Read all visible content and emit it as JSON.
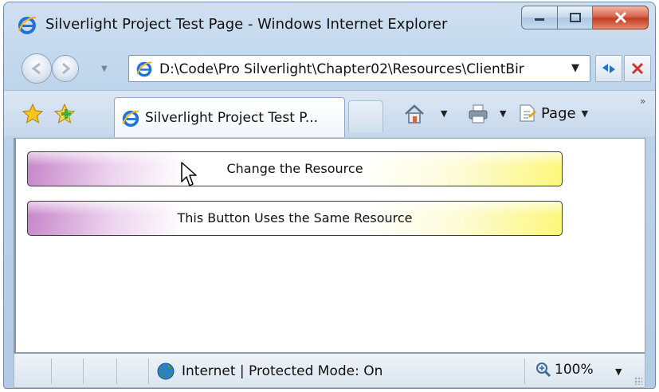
{
  "window": {
    "title": "Silverlight Project Test Page - Windows Internet Explorer"
  },
  "address_bar": {
    "url": "D:\\Code\\Pro Silverlight\\Chapter02\\Resources\\ClientBir"
  },
  "tab": {
    "label": "Silverlight Project Test P..."
  },
  "command_bar": {
    "page_label": "Page"
  },
  "content": {
    "buttons": [
      {
        "label": "Change the Resource"
      },
      {
        "label": "This Button Uses the Same Resource"
      }
    ],
    "button_gradient": {
      "start": "#c685c9",
      "middle": "#ffffff",
      "end": "#fbf77a"
    }
  },
  "status_bar": {
    "zone_text": "Internet | Protected Mode: On",
    "zoom": "100%"
  },
  "icons": [
    "ie-logo-icon",
    "back-icon",
    "forward-icon",
    "refresh-icon",
    "stop-icon",
    "favorites-star-icon",
    "add-favorites-icon",
    "home-icon",
    "print-icon",
    "page-icon",
    "globe-icon",
    "zoom-icon",
    "mouse-cursor-icon"
  ]
}
